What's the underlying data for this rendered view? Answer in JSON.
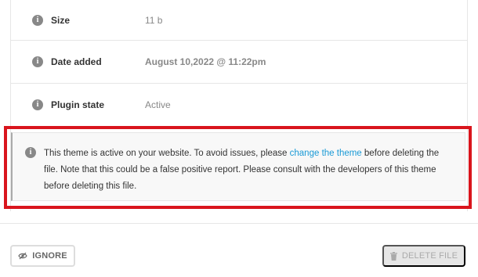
{
  "details": {
    "size": {
      "label": "Size",
      "value": "11 b",
      "icon": "info-icon"
    },
    "date_added": {
      "label": "Date added",
      "value": "August 10,2022 @ 11:22pm",
      "icon": "info-icon"
    },
    "plugin_state": {
      "label": "Plugin state",
      "value": "Active",
      "icon": "info-icon"
    }
  },
  "notice": {
    "icon": "info-icon",
    "text_before": "This theme is active on your website. To avoid issues, please ",
    "link_text": "change the theme",
    "text_after": " before deleting the file. Note that this could be a false positive report. Please consult with the developers of this theme before deleting this file."
  },
  "actions": {
    "ignore_label": "IGNORE",
    "ignore_icon": "eye-slash-icon",
    "delete_label": "DELETE FILE",
    "delete_icon": "trash-icon"
  },
  "colors": {
    "highlight": "#d9151d",
    "link": "#1a9ad6",
    "icon_grey": "#888888"
  }
}
